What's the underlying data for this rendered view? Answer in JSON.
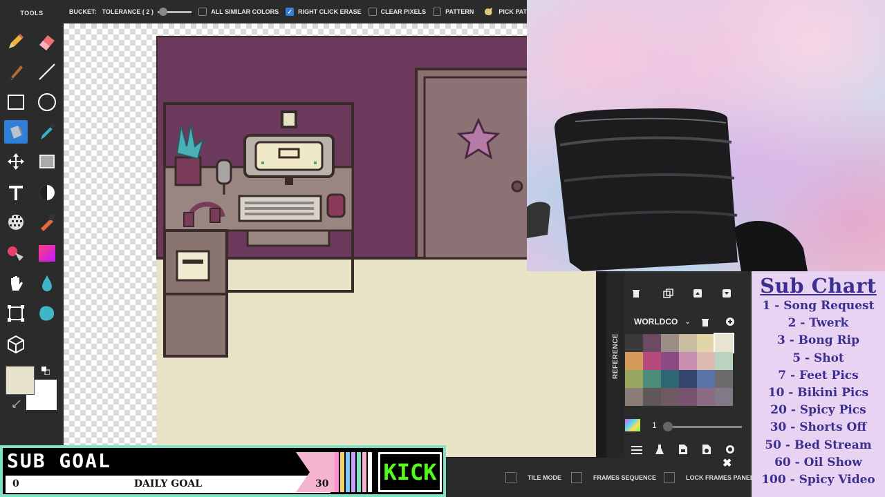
{
  "tools": {
    "title": "TOOLS",
    "items": [
      "pencil-icon",
      "eraser-icon",
      "brush-icon",
      "line-icon",
      "rectangle-icon",
      "ellipse-icon",
      "bucket-icon",
      "eyedropper-icon",
      "move-icon",
      "select-icon",
      "text-icon",
      "contrast-icon",
      "dither-icon",
      "stamp-icon",
      "color-replace-icon",
      "gradient-icon",
      "hand-icon",
      "drop-icon",
      "crop-icon",
      "blob-icon",
      "cube-icon"
    ],
    "primary_color": "#e7e2cc",
    "secondary_color": "#ffffff"
  },
  "toolbar": {
    "bucket_label": "BUCKET:",
    "tolerance_label": "TOLERANCE ( 2 )",
    "all_similar_label": "ALL SIMILAR COLORS",
    "right_click_label": "RIGHT CLICK ERASE",
    "clear_pixels_label": "CLEAR PIXELS",
    "pattern_label": "PATTERN",
    "pick_pattern_label": "PICK PAT"
  },
  "right_panel": {
    "tab_label": "REFERENCE",
    "palette_name": "WORLDCO",
    "opacity_value": "1",
    "palette": [
      "#3a3a3a",
      "#6b4a63",
      "#9c8d86",
      "#c9bca0",
      "#e2d6a8",
      "#e9e4d2",
      "#d49a5a",
      "#b74a7c",
      "#8a4a82",
      "#c98fb0",
      "#ddb9b4",
      "#b9d3c0",
      "#98a860",
      "#4e8c7a",
      "#2e6673",
      "#34466b",
      "#5a73a8",
      "#6b6b6b",
      "#8c7c77",
      "#5f5757",
      "#6e5b62",
      "#7a5370",
      "#8b6a86",
      "#7f7a86"
    ]
  },
  "bottombar": {
    "tile_mode_label": "TILE MODE",
    "frames_sequence_label": "FRAMES SEQUENCE",
    "lock_frames_label": "LOCK FRAMES PANEL"
  },
  "sub_chart": {
    "title": "Sub Chart",
    "rows": [
      "1 - Song Request",
      "2 - Twerk",
      "3 - Bong Rip",
      "5 - Shot",
      "7 - Feet Pics",
      "10 - Bikini Pics",
      "20 - Spicy Pics",
      "30 - Shorts Off",
      "50 - Bed Stream",
      "60 - Oil Show",
      "100 - Spicy Video"
    ]
  },
  "goal": {
    "title": "SUB GOAL",
    "label": "DAILY GOAL",
    "min": "0",
    "max": "30",
    "current": 0,
    "platform": "KICK"
  }
}
